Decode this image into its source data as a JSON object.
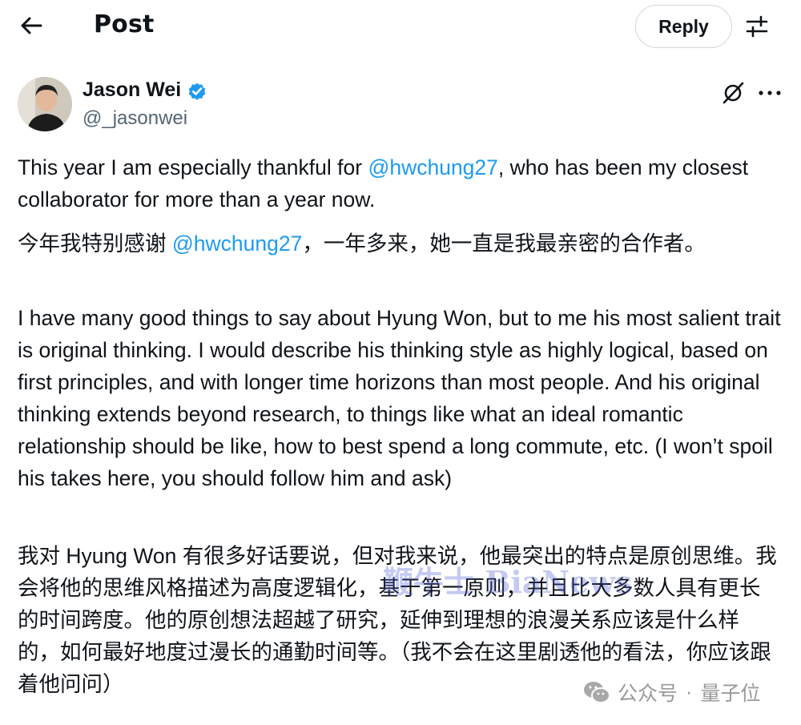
{
  "header": {
    "title": "Post",
    "reply_label": "Reply",
    "back_icon": "arrow-left-icon",
    "filter_icon": "sliders-icon"
  },
  "author": {
    "name": "Jason Wei",
    "handle": "@_jasonwei",
    "verified": true,
    "verified_color": "#1d9bf0"
  },
  "post": {
    "p1_before": "This year I am especially thankful for ",
    "p1_mention": "@hwchung27",
    "p1_after": ", who has been my closest collaborator for more than a year now.",
    "p2_before": "今年我特别感谢 ",
    "p2_mention": "@hwchung27",
    "p2_after": "，一年多来，她一直是我最亲密的合作者。",
    "p3": "I have many good things to say about Hyung Won, but to me his most salient trait is original thinking. I would describe his thinking style as highly logical, based on first principles, and with longer time horizons than most people. And his original thinking extends beyond research, to things like what an ideal romantic relationship should be like, how to best spend a long commute, etc. (I won’t spoil his takes here, you should follow him and ask)",
    "p4": "我对 Hyung Won 有很多好话要说，但对我来说，他最突出的特点是原创思维。我会将他的思维风格描述为高度逻辑化，基于第一原则，并且比大多数人具有更长的时间跨度。他的原创想法超越了研究，延伸到理想的浪漫关系应该是什么样的，如何最好地度过漫长的通勤时间等。（我不会在这里剧透他的看法，你应该跟着他问问）"
  },
  "overlay": {
    "watermark": "鞭牛士 BiaNews",
    "source_account": "公众号",
    "source_separator": "·",
    "source_name": "量子位"
  },
  "colors": {
    "accent": "#1d9bf0",
    "text": "#0f1419",
    "secondary": "#536471"
  }
}
